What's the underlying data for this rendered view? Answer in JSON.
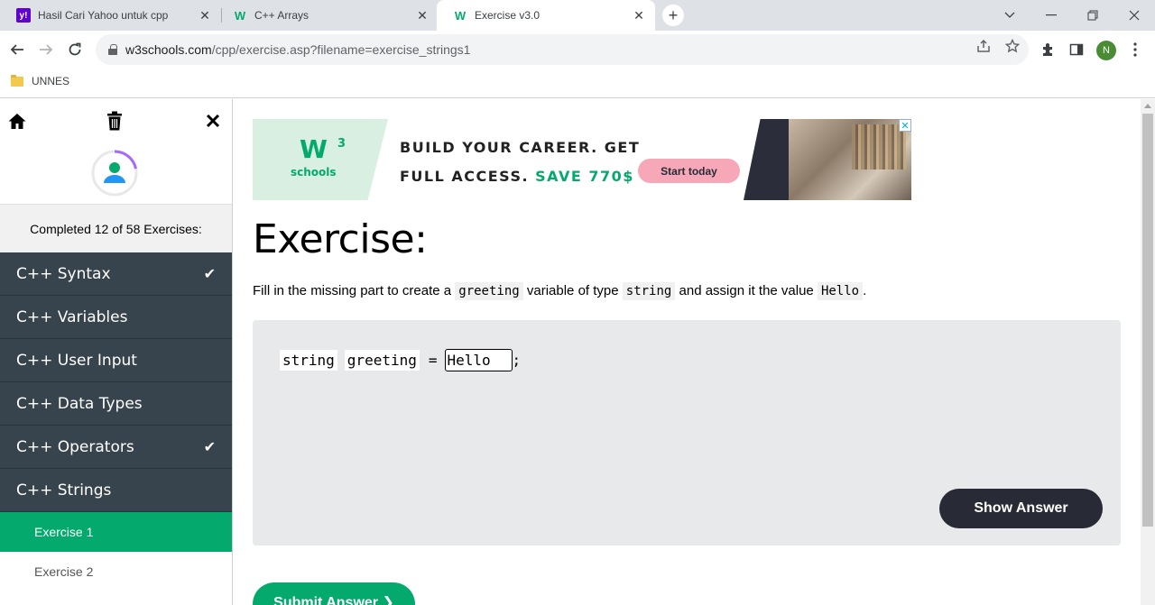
{
  "browser": {
    "tabs": [
      {
        "title": "Hasil Cari Yahoo untuk cpp",
        "favicon": "yahoo-icon",
        "color": "#6001d2"
      },
      {
        "title": "C++ Arrays",
        "favicon": "w3schools-icon",
        "color": "#04aa6d"
      },
      {
        "title": "Exercise v3.0",
        "favicon": "w3schools-icon",
        "color": "#04aa6d"
      }
    ],
    "url_host": "w3schools.com",
    "url_path": "/cpp/exercise.asp?filename=exercise_strings1",
    "profile_initial": "N",
    "bookmark_label": "UNNES"
  },
  "sidebar": {
    "completed_text": "Completed 12 of 58 Exercises:",
    "categories": [
      {
        "label": "C++ Syntax",
        "done": true
      },
      {
        "label": "C++ Variables",
        "done": false
      },
      {
        "label": "C++ User Input",
        "done": false
      },
      {
        "label": "C++ Data Types",
        "done": false
      },
      {
        "label": "C++ Operators",
        "done": true
      },
      {
        "label": "C++ Strings",
        "done": false
      }
    ],
    "check_glyph": "✔",
    "exercises": [
      {
        "label": "Exercise 1",
        "active": true
      },
      {
        "label": "Exercise 2",
        "active": false
      }
    ]
  },
  "ad": {
    "logo_text": "W",
    "logo_sup": "3",
    "logo_sub": "schools",
    "line1": "BUILD YOUR CAREER. GET",
    "line2_prefix": "FULL ACCESS. ",
    "line2_highlight": "SAVE 770$",
    "cta": "Start today",
    "close": "✕"
  },
  "exercise": {
    "title": "Exercise:",
    "instruction_parts": [
      "Fill in the missing part to create a ",
      "greeting",
      " variable of type ",
      "string",
      " and assign it the value ",
      "Hello",
      "."
    ],
    "code_tokens": [
      "string",
      "greeting",
      "="
    ],
    "answer_value": "Hello",
    "semicolon": ";",
    "show_answer_label": "Show Answer",
    "submit_label": "Submit Answer ❯"
  },
  "colors": {
    "brand_green": "#04aa6d",
    "sidebar_dark": "#38444d",
    "button_dark": "#282a35"
  }
}
